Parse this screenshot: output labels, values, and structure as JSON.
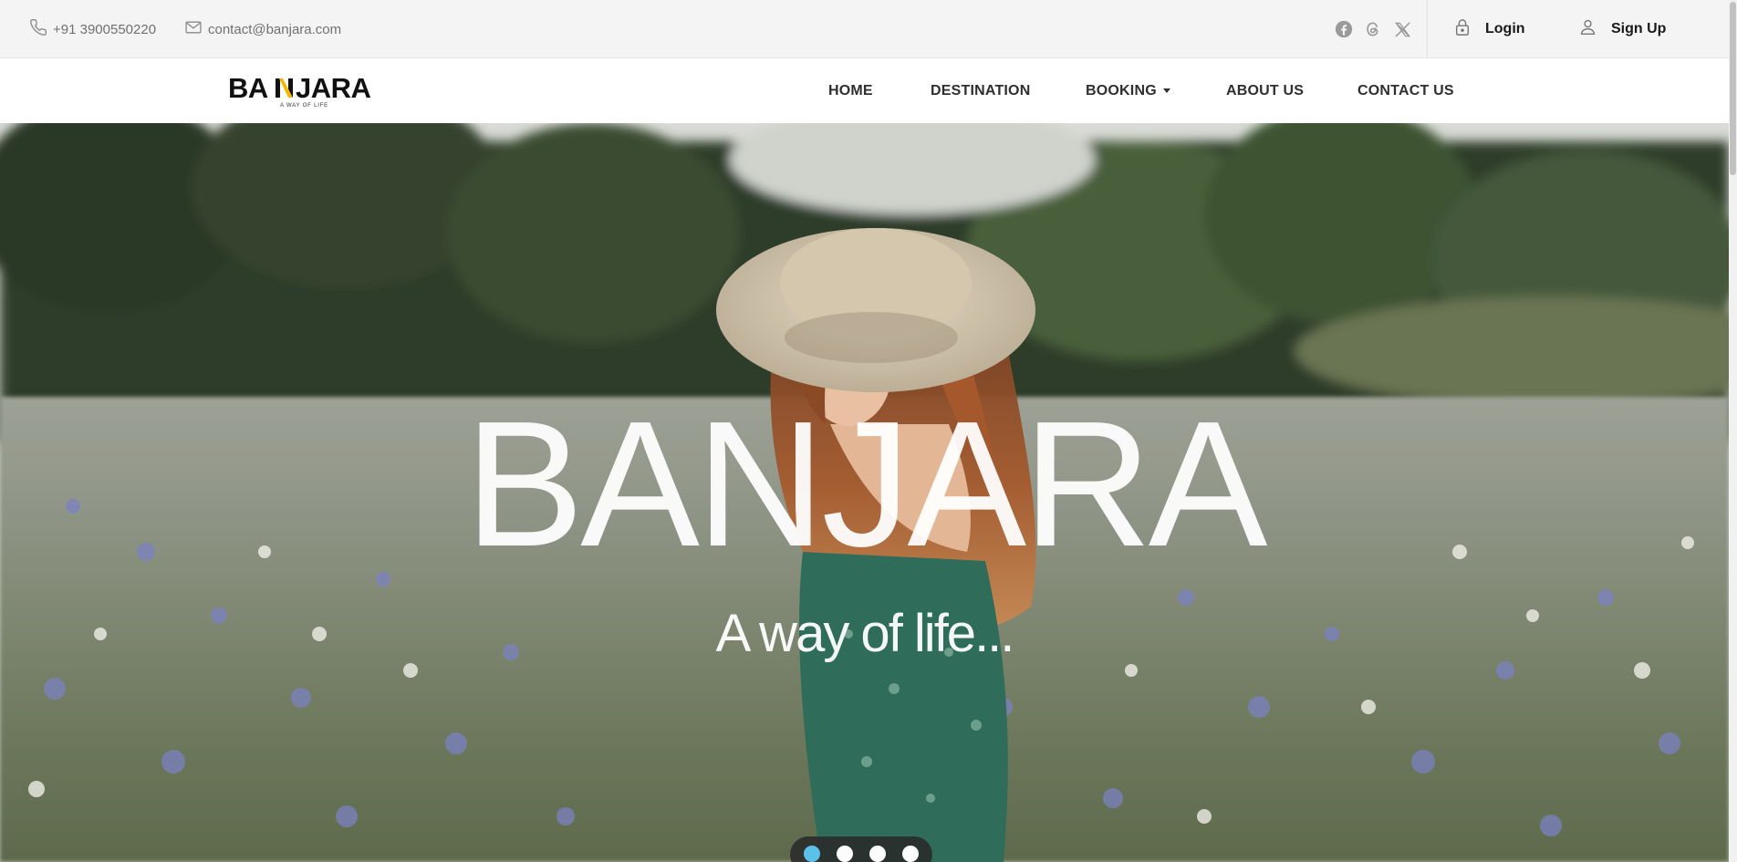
{
  "topbar": {
    "phone": "+91 3900550220",
    "email": "contact@banjara.com",
    "social_icons": [
      "facebook-icon",
      "threads-icon",
      "x-twitter-icon"
    ],
    "login_label": "Login",
    "signup_label": "Sign Up"
  },
  "brand": {
    "logo_text_left": "BA",
    "logo_text_right": "JARA",
    "tagline": "A WAY OF LIFE",
    "accent_color": "#f5b800"
  },
  "nav": {
    "home": "HOME",
    "destination": "DESTINATION",
    "booking": "BOOKING",
    "about": "ABOUT US",
    "contact": "CONTACT US"
  },
  "hero": {
    "title": "BANJARA",
    "subtitle": "A way of life...",
    "slide_count": 4,
    "active_slide": 1,
    "active_dot_color": "#5cc1ea"
  }
}
